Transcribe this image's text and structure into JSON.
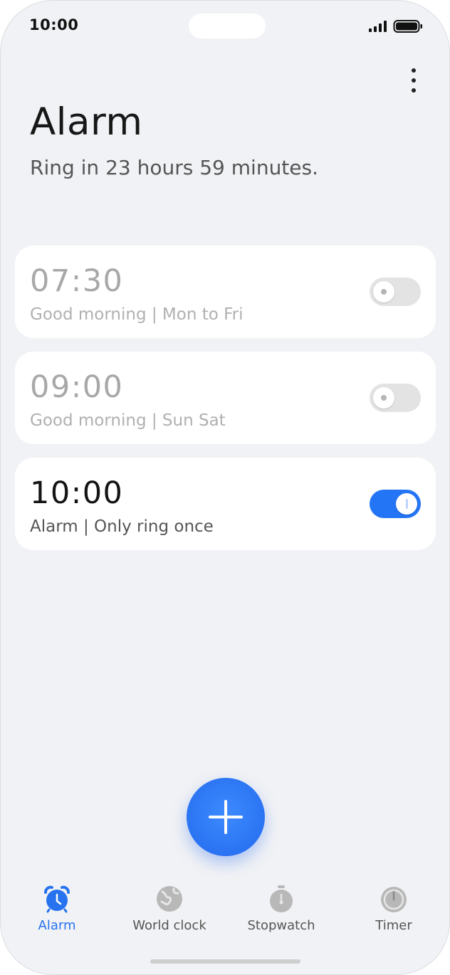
{
  "status_bar": {
    "time": "10:00"
  },
  "header": {
    "title": "Alarm",
    "subtitle": "Ring in 23 hours 59 minutes.",
    "more_icon": "more-vertical-icon"
  },
  "alarms": [
    {
      "time": "07:30",
      "description": "Good morning | Mon to Fri",
      "enabled": false
    },
    {
      "time": "09:00",
      "description": "Good morning | Sun Sat",
      "enabled": false
    },
    {
      "time": "10:00",
      "description": "Alarm | Only ring once",
      "enabled": true
    }
  ],
  "fab": {
    "icon": "plus-icon"
  },
  "bottom_nav": {
    "items": [
      {
        "label": "Alarm",
        "icon": "alarm-clock-icon",
        "active": true
      },
      {
        "label": "World clock",
        "icon": "globe-icon",
        "active": false
      },
      {
        "label": "Stopwatch",
        "icon": "stopwatch-icon",
        "active": false
      },
      {
        "label": "Timer",
        "icon": "timer-icon",
        "active": false
      }
    ]
  },
  "colors": {
    "accent": "#2773ef",
    "background": "#f1f2f5",
    "card": "#ffffff",
    "toggle_off": "#e3e3e3",
    "inactive_icon": "#b5b5b5"
  }
}
